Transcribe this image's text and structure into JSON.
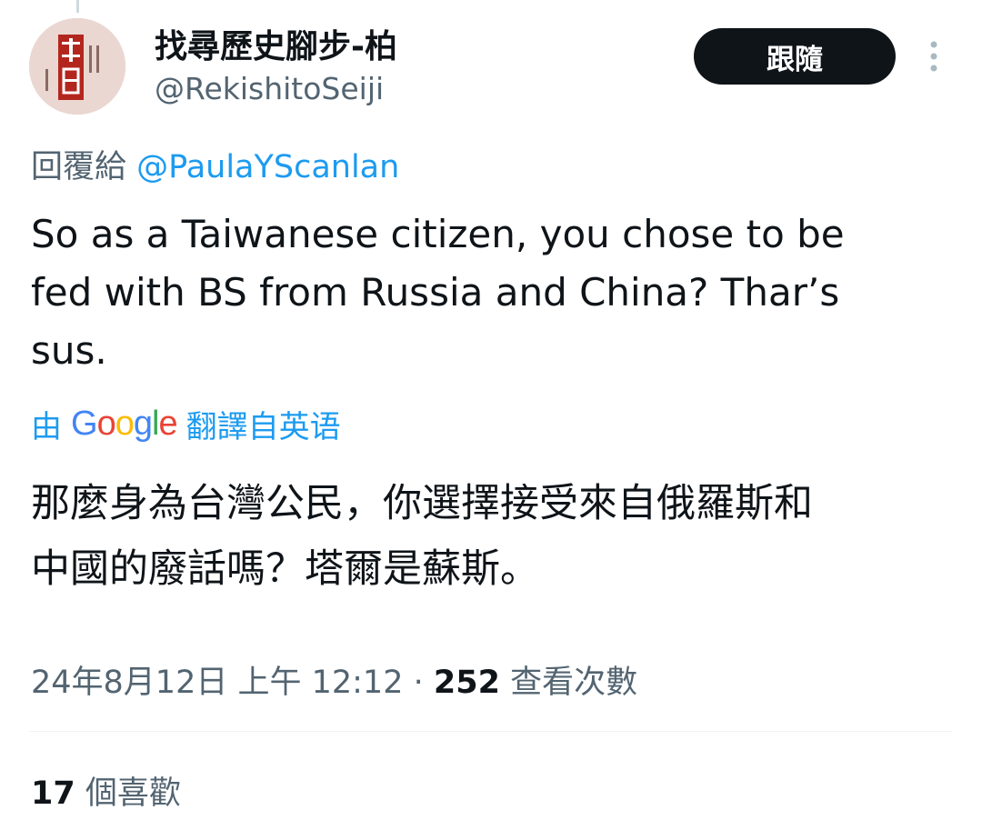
{
  "author": {
    "display_name": "找尋歷史腳步-柏",
    "handle": "@RekishitoSeiji",
    "avatar_icon": "sake-label-avatar"
  },
  "follow_button": {
    "label": "跟隨"
  },
  "more_menu": {
    "icon": "vertical-ellipsis-icon"
  },
  "reply": {
    "prefix": "回覆給",
    "handle": "@PaulaYScanlan"
  },
  "tweet": {
    "lines": [
      "So as a Taiwanese citizen, you chose to be",
      "fed with BS from Russia and China? Thar’s",
      "sus."
    ]
  },
  "translation": {
    "prefix": "由",
    "provider": "Google",
    "suffix": "翻譯自英语",
    "lines": [
      "那麼身為台灣公民，你選擇接受來自俄羅斯和",
      "中國的廢話嗎？塔爾是蘇斯。"
    ]
  },
  "meta": {
    "timestamp": "24年8月12日 上午 12:12",
    "separator": " · ",
    "views_count": "252",
    "views_label": "查看次數"
  },
  "likes": {
    "count": "17",
    "label": "個喜歡"
  },
  "colors": {
    "link": "#1d9bf0",
    "text_primary": "#0f1419",
    "text_secondary": "#536471",
    "button_bg": "#0f1419"
  }
}
